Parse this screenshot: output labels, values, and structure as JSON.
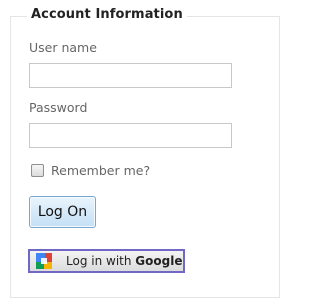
{
  "form": {
    "legend": "Account Information",
    "username": {
      "label": "User name",
      "value": "",
      "placeholder": ""
    },
    "password": {
      "label": "Password",
      "value": "",
      "placeholder": ""
    },
    "remember": {
      "label": "Remember me?",
      "checked": false
    },
    "logon_button": "Log On",
    "google_button": {
      "prefix": "Log in with ",
      "brand": "Google",
      "icon": "google-icon"
    }
  },
  "colors": {
    "legend_text": "#222222",
    "label_text": "#666666",
    "logon_border": "#7aa7cf",
    "google_border": "#7068c4",
    "google_blue": "#4285f4",
    "google_red": "#db4437",
    "google_yellow": "#f4b400",
    "google_green": "#0f9d58"
  }
}
